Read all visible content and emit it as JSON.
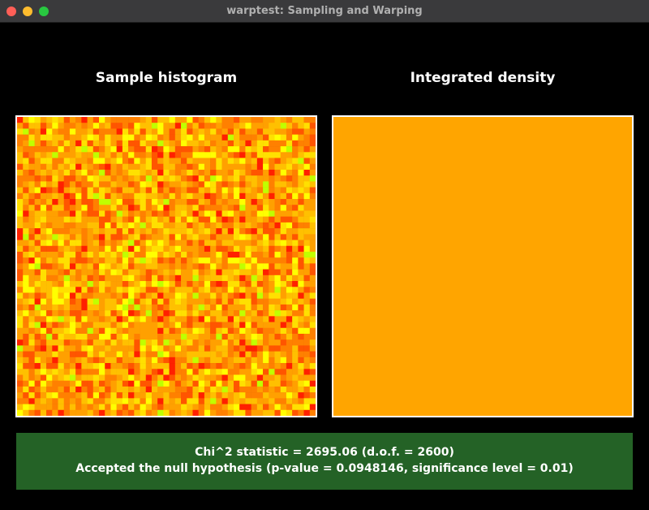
{
  "window": {
    "title": "warptest: Sampling and Warping",
    "traffic_lights": {
      "close_color": "#ff5f57",
      "minimize_color": "#febc2e",
      "zoom_color": "#28c840"
    }
  },
  "panels": {
    "left": {
      "heading": "Sample histogram"
    },
    "right": {
      "heading": "Integrated density",
      "fill_color": "#ffa500"
    }
  },
  "histogram": {
    "grid_size": 51,
    "colormap": [
      "#ff2000",
      "#ff5500",
      "#ff8000",
      "#ffa000",
      "#ffc000",
      "#ffe000",
      "#ffff00",
      "#c0ff00"
    ]
  },
  "result": {
    "line1": "Chi^2 statistic = 2695.06 (d.o.f. = 2600)",
    "line2": "Accepted the null hypothesis (p-value = 0.0948146, significance level = 0.01)",
    "background_color": "#246226"
  }
}
